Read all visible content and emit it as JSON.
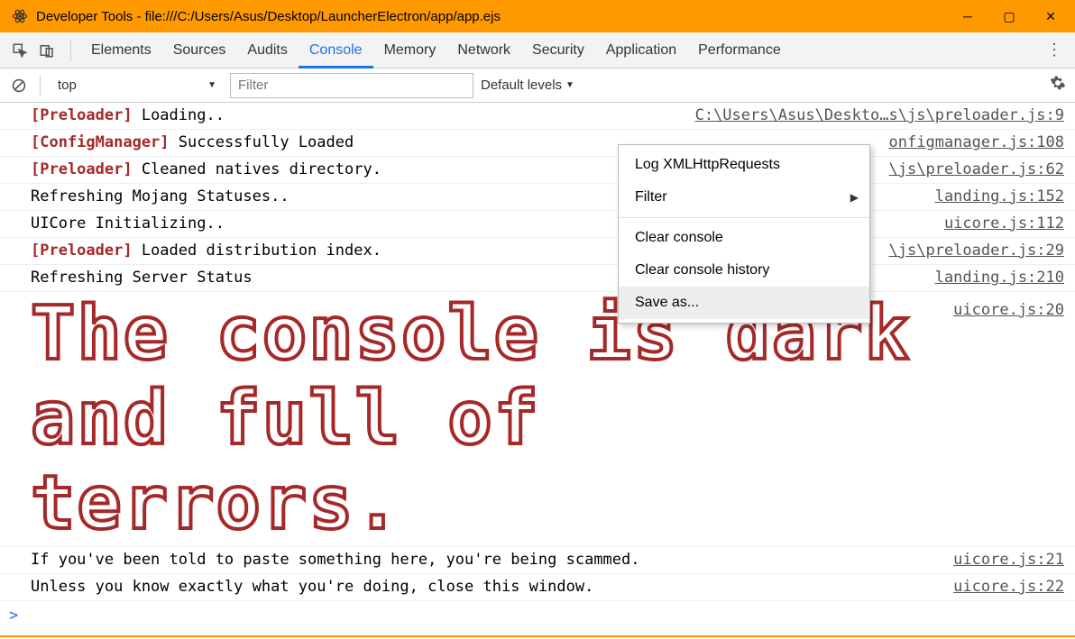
{
  "window": {
    "title": "Developer Tools - file:///C:/Users/Asus/Desktop/LauncherElectron/app/app.ejs"
  },
  "tabs": [
    "Elements",
    "Sources",
    "Audits",
    "Console",
    "Memory",
    "Network",
    "Security",
    "Application",
    "Performance"
  ],
  "activeTab": "Console",
  "filterbar": {
    "context": "top",
    "filterPlaceholder": "Filter",
    "levels": "Default levels"
  },
  "logs": [
    {
      "tag": "[Preloader]",
      "msg": " Loading..",
      "src": "C:\\Users\\Asus\\Deskto…s\\js\\preloader.js:9"
    },
    {
      "tag": "[ConfigManager]",
      "msg": " Successfully Loaded",
      "src": "onfigmanager.js:108"
    },
    {
      "tag": "[Preloader]",
      "msg": " Cleaned natives directory.",
      "src": "\\js\\preloader.js:62"
    },
    {
      "tag": "",
      "msg": "Refreshing Mojang Statuses..",
      "src": "landing.js:152"
    },
    {
      "tag": "",
      "msg": "UICore Initializing..",
      "src": "uicore.js:112"
    },
    {
      "tag": "[Preloader]",
      "msg": " Loaded distribution index.",
      "src": "\\js\\preloader.js:29"
    },
    {
      "tag": "",
      "msg": "Refreshing Server Status",
      "src": "landing.js:210"
    }
  ],
  "bigMessage": {
    "text": "The console is dark and full of terrors.",
    "src": "uicore.js:20"
  },
  "warn1": {
    "msg": "If you've been told to paste something here, you're being scammed.",
    "src": "uicore.js:21"
  },
  "warn2": {
    "msg": "Unless you know exactly what you're doing, close this window.",
    "src": "uicore.js:22"
  },
  "prompt": ">",
  "contextMenu": {
    "items": [
      "Log XMLHttpRequests",
      "Filter"
    ],
    "items2": [
      "Clear console",
      "Clear console history",
      "Save as..."
    ],
    "hovered": "Save as..."
  }
}
